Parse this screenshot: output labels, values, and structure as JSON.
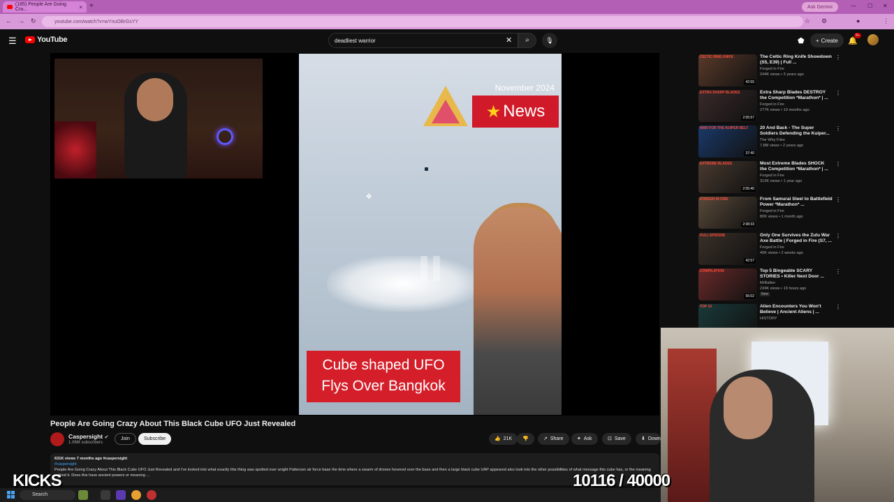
{
  "browser": {
    "tab_title": "(185) People Are Going Cra...",
    "url": "youtube.com/watch?v=wYnuOBrGsYY",
    "gemini_label": "Ask Gemini"
  },
  "youtube": {
    "logo_text": "YouTube",
    "search_value": "deadliest warrior",
    "create_label": "Create",
    "notif_badge": "9+"
  },
  "video": {
    "date_label": "November 2024",
    "news_label": "News",
    "caption_line1": "Cube shaped UFO",
    "caption_line2": "Flys Over Bangkok",
    "title": "People Are Going Crazy About This Black Cube UFO Just Revealed",
    "channel_name": "Caspersight",
    "channel_subs": "1.06M subscribers",
    "join_label": "Join",
    "subscribe_label": "Subscribe",
    "like_count": "21K",
    "share_label": "Share",
    "ask_label": "Ask",
    "save_label": "Save",
    "download_label": "Down",
    "desc_meta": "631K views  7 months ago  #caspersight",
    "desc_tag": "#caspersight",
    "desc_text": "People Are Going Crazy About This Black Cube UFO Just Revealed and I've looked into what exactly this thing was spotted over wright Patterson air force base the time where a swarm of drones hovered over the base and then a large black cube UAP appeared also look into the other possibilities of what message this cube has, or the meaning behind it. Does this have ancient powers or meaning ...",
    "desc_more": "...more"
  },
  "recommendations": [
    {
      "thumb_text": "CELTIC RING KNIFE",
      "title": "The Celtic Ring Knife Showdown (S5, E39) | Full ...",
      "channel": "Forged in Fire",
      "meta": "244K views • 3 years ago",
      "duration": "42:55",
      "thumb_color": "#5a3a2a"
    },
    {
      "thumb_text": "EXTRA SHARP BLADES",
      "title": "Extra Sharp Blades DESTROY the Competition *Marathon* | ...",
      "channel": "Forged in Fire",
      "meta": "277K views • 10 months ago",
      "duration": "2:05:57",
      "thumb_color": "#3a2a2a"
    },
    {
      "thumb_text": "WAR FOR THE KUIPER BELT",
      "title": "20 And Back - The Super Soldiers Defending the Kuiper...",
      "channel": "The Why Files",
      "meta": "7.8M views • 2 years ago",
      "duration": "37:40",
      "thumb_color": "#1a3a6a"
    },
    {
      "thumb_text": "EXTREME BLADES",
      "title": "Most Extreme Blades SHOCK the Competition *Marathon* | ...",
      "channel": "Forged in Fire",
      "meta": "313K views • 1 year ago",
      "duration": "2:05:40",
      "thumb_color": "#4a3a30"
    },
    {
      "thumb_text": "FORGED IN FIRE",
      "title": "From Samurai Steel to Battlefield Power *Marathon* ...",
      "channel": "Forged in Fire",
      "meta": "80K views • 1 month ago",
      "duration": "2:08:33",
      "thumb_color": "#5a4a3a"
    },
    {
      "thumb_text": "FULL EPISODE",
      "title": "Only One Survives the Zulu War Axe Battle | Forged in Fire (S7, ...",
      "channel": "Forged in Fire",
      "meta": "40K views • 2 weeks ago",
      "duration": "42:57",
      "thumb_color": "#3a3028"
    },
    {
      "thumb_text": "COMPILATION",
      "title": "Top 5 Bingeable SCARY STORIES • Killer Next Door ...",
      "channel": "MrBallen",
      "meta": "234K views • 19 hours ago",
      "duration": "56:02",
      "thumb_color": "#6a2a2a",
      "badge": "New"
    },
    {
      "thumb_text": "TOP 10",
      "title": "Alien Encounters You Won't Believe | Ancient Aliens | ...",
      "channel": "HISTORY",
      "meta": "",
      "duration": "",
      "thumb_color": "#1a3a3a"
    }
  ],
  "overlay": {
    "kicks_label": "KICKS",
    "goal_text": "10116 / 40000"
  },
  "taskbar": {
    "search_label": "Search"
  }
}
